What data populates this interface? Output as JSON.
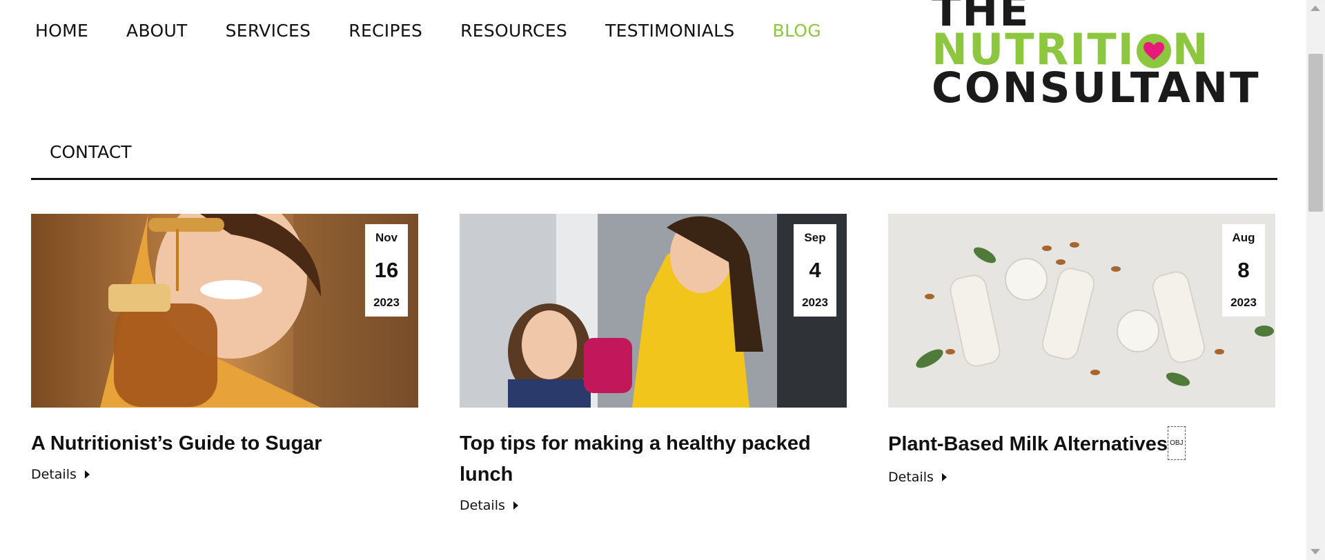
{
  "nav": {
    "items": [
      {
        "label": "HOME"
      },
      {
        "label": "ABOUT"
      },
      {
        "label": "SERVICES"
      },
      {
        "label": "RECIPES"
      },
      {
        "label": "RESOURCES"
      },
      {
        "label": "TESTIMONIALS"
      },
      {
        "label": "BLOG",
        "active": true
      }
    ],
    "contact": "CONTACT",
    "active_color": "#8dc63f"
  },
  "logo": {
    "line1": "THE",
    "line2_a": "NUTRITI",
    "line2_b": "N",
    "line3": "CONSULTANT",
    "green": "#8dc63f",
    "heart": "#e8197a",
    "icon": "heart-icon"
  },
  "posts": [
    {
      "month": "Nov",
      "day": "16",
      "year": "2023",
      "title": "A Nutritionist’s Guide to Sugar",
      "details": "Details",
      "image": "woman-eating-honey-photo"
    },
    {
      "month": "Sep",
      "day": "4",
      "year": "2023",
      "title": "Top tips for making a healthy packed lunch",
      "details": "Details",
      "image": "mother-daughter-lunchbox-photo"
    },
    {
      "month": "Aug",
      "day": "8",
      "year": "2023",
      "title": "Plant-Based Milk Alternatives",
      "obj": "OBJ",
      "details": "Details",
      "image": "plant-milk-bottles-photo"
    }
  ]
}
